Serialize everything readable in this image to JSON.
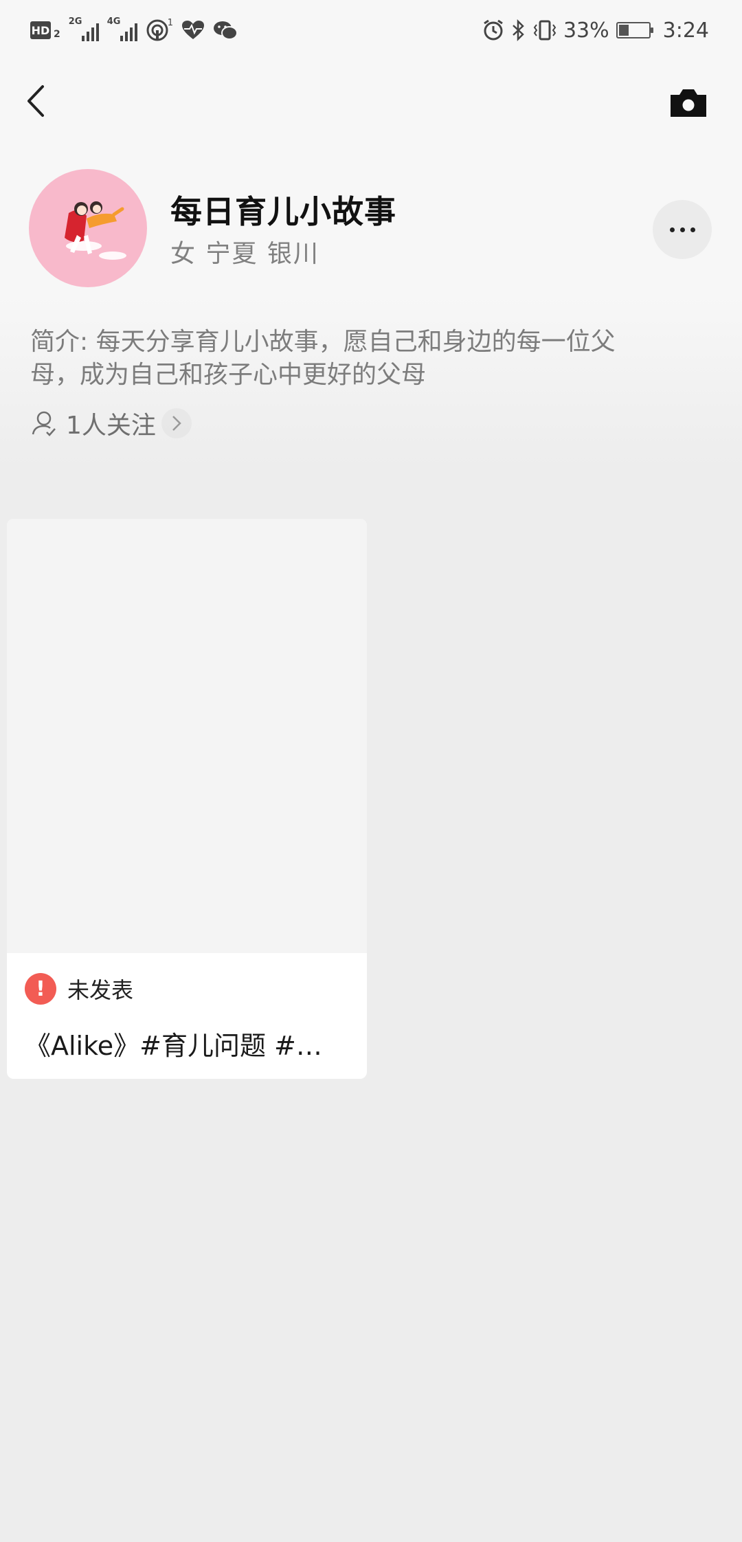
{
  "status_bar": {
    "network_badge": "HD",
    "network_badge_sub": "2",
    "signal1_label": "2G",
    "signal2_label": "4G",
    "hotspot_count": "1",
    "battery_percent": "33%",
    "time": "3:24",
    "battery_level": 0.33
  },
  "profile": {
    "name": "每日育儿小故事",
    "meta": "女 宁夏 银川",
    "intro": "简介: 每天分享育儿小故事，愿自己和身边的每一位父母，成为自己和孩子心中更好的父母",
    "followers": "1人关注"
  },
  "post": {
    "status": "未发表",
    "warning_glyph": "!",
    "title": "《Alike》#育儿问题 #育…"
  },
  "colors": {
    "avatar_bg": "#f8b9cb",
    "warning": "#f25c54",
    "page_bg": "#ededed"
  }
}
